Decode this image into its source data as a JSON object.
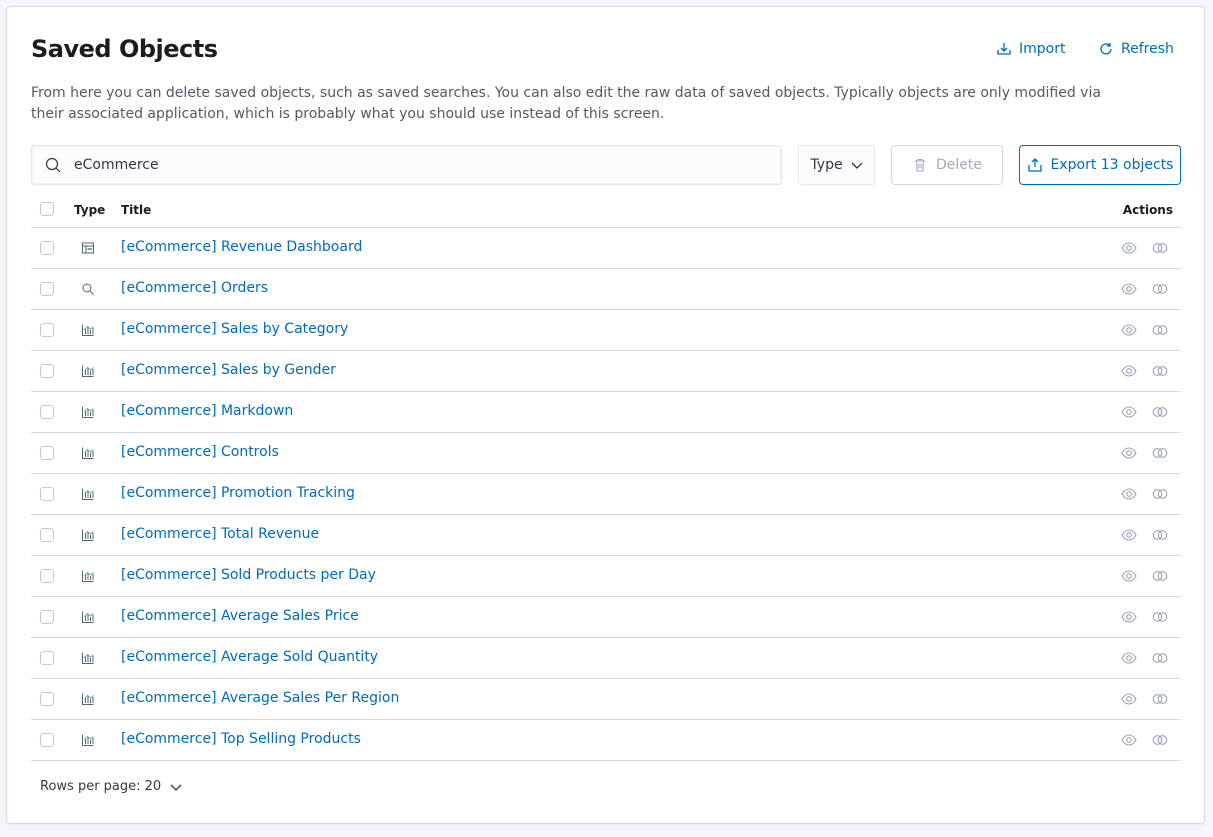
{
  "header": {
    "title": "Saved Objects",
    "import_label": "Import",
    "refresh_label": "Refresh",
    "description": "From here you can delete saved objects, such as saved searches. You can also edit the raw data of saved objects. Typically objects are only modified via their associated application, which is probably what you should use instead of this screen."
  },
  "toolbar": {
    "search_value": "eCommerce",
    "type_filter_label": "Type",
    "delete_label": "Delete",
    "export_label": "Export 13 objects"
  },
  "table": {
    "columns": {
      "type": "Type",
      "title": "Title",
      "actions": "Actions"
    },
    "rows": [
      {
        "type": "dashboard",
        "title": "[eCommerce] Revenue Dashboard"
      },
      {
        "type": "search",
        "title": "[eCommerce] Orders"
      },
      {
        "type": "visualization",
        "title": "[eCommerce] Sales by Category"
      },
      {
        "type": "visualization",
        "title": "[eCommerce] Sales by Gender"
      },
      {
        "type": "visualization",
        "title": "[eCommerce] Markdown"
      },
      {
        "type": "visualization",
        "title": "[eCommerce] Controls"
      },
      {
        "type": "visualization",
        "title": "[eCommerce] Promotion Tracking"
      },
      {
        "type": "visualization",
        "title": "[eCommerce] Total Revenue"
      },
      {
        "type": "visualization",
        "title": "[eCommerce] Sold Products per Day"
      },
      {
        "type": "visualization",
        "title": "[eCommerce] Average Sales Price"
      },
      {
        "type": "visualization",
        "title": "[eCommerce] Average Sold Quantity"
      },
      {
        "type": "visualization",
        "title": "[eCommerce] Average Sales Per Region"
      },
      {
        "type": "visualization",
        "title": "[eCommerce] Top Selling Products"
      }
    ]
  },
  "pagination": {
    "rows_per_page_label": "Rows per page: 20"
  },
  "colors": {
    "link": "#006bb8",
    "border": "#d3dae6",
    "text": "#343741",
    "muted": "#a2abba"
  },
  "icons": {
    "import": "import-icon",
    "refresh": "refresh-icon",
    "search": "search-icon",
    "delete": "trash-icon",
    "export": "export-icon",
    "inspect": "eye-icon",
    "relationships": "relationships-icon",
    "dashboard": "dashboard-app-icon",
    "visualization": "visualize-app-icon",
    "chevron": "chevron-down-icon"
  }
}
